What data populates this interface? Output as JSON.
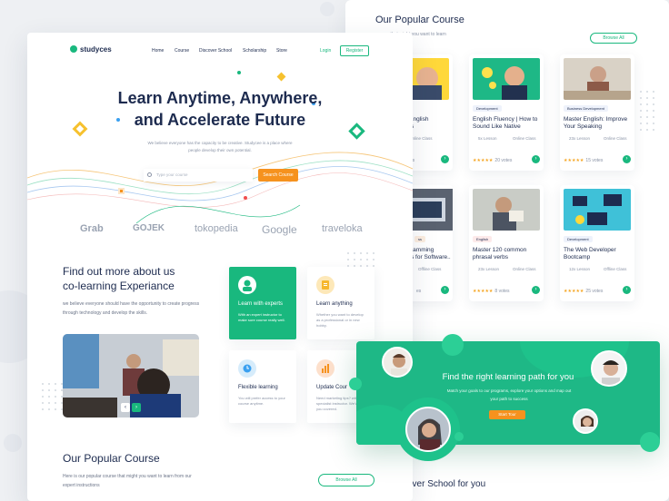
{
  "colors": {
    "brand": "#19b87e",
    "accent": "#f6921e",
    "ink": "#1d2b4f"
  },
  "back": {
    "title": "Our Popular Course",
    "subtitle": "course that might you want to learn\nructions",
    "browse": "Browse All",
    "cards": [
      {
        "tag": "",
        "title": "ive English\nSkills",
        "lesson": "",
        "class": "Online Class",
        "votes": "rs"
      },
      {
        "tag": "Development",
        "title": "English Fluency | How to Sound Like Native",
        "lesson": "5x Lesson",
        "class": "Online Class",
        "votes": "20 votes"
      },
      {
        "tag": "Business Development",
        "title": "Master English: Improve Your Speaking",
        "lesson": "23x Lesson",
        "class": "Online Class",
        "votes": "15 votes"
      },
      {
        "tag": "ss",
        "title": "ramming\ns for Software..",
        "lesson": "",
        "class": "Offline Class",
        "votes": "es"
      },
      {
        "tag": "English",
        "title": "Master 120 common phrasal verbs",
        "lesson": "23x Lesson",
        "class": "Online Class",
        "votes": "8 votes"
      },
      {
        "tag": "Development",
        "title": "The Web Developer Bootcamp",
        "lesson": "12x Lesson",
        "class": "Offline Class",
        "votes": "25 votes"
      }
    ]
  },
  "front": {
    "logo": "studyces",
    "nav": [
      "Home",
      "Course",
      "Discover School",
      "Scholarship",
      "Store"
    ],
    "login": "Login",
    "register": "Register",
    "hero_line1": "Learn Anytime, Anywhere,",
    "hero_line2": "and Accelerate Future",
    "hero_sub": "We believe everyone has the capacity to be creative. Studycee is a place where people develop their own potential.",
    "search_placeholder": "Type your course",
    "search_button": "Search Course",
    "brands": [
      "Grab",
      "GOJEK",
      "tokopedia",
      "Google",
      "traveloka"
    ],
    "about_line1": "Find out more about us",
    "about_line2": "co-learning Experiance",
    "about_text": "we believe everyone should have the opportunity to create progress through technology and develop the skills.",
    "features": [
      {
        "title": "Learn with experts",
        "text": "With an expert instructor to make sure course really well."
      },
      {
        "title": "Learn anything",
        "text": "Whether you want to develop as a professional or in new hobby."
      },
      {
        "title": "Flexible learning",
        "text": "You will prefer access to your course anytime."
      },
      {
        "title": "Update Cour",
        "text": "Need marketing tips? with a specialist instructor. We've got you covered."
      }
    ],
    "popular_title": "Our Popular Course",
    "popular_text": "Here is our popular course that might you want to learn from our expert instructions",
    "browse": "Browse All"
  },
  "banner": {
    "title": "Find the right learning path for you",
    "sub": "Match your goals to our programs, explore your options and map out your path to success",
    "button": "Start Tour"
  },
  "discover": "over School for you"
}
